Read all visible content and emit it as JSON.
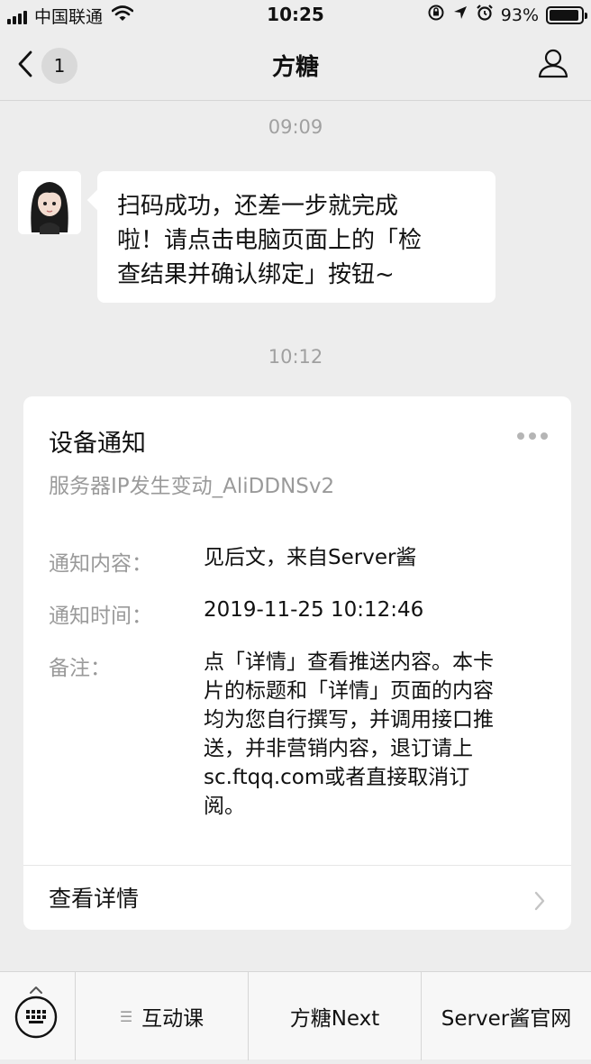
{
  "status_bar": {
    "carrier": "中国联通",
    "time": "10:25",
    "battery": "93%",
    "battery_level": 0.93
  },
  "nav": {
    "back_badge": "1",
    "title": "方糖"
  },
  "messages": {
    "time1": "09:09",
    "bubble_lines": [
      "扫码成功，还差一步就完成",
      "啦！请点击电脑页面上的「检",
      "查结果并确认绑定」按钮~"
    ],
    "time2": "10:12"
  },
  "card": {
    "title": "设备通知",
    "subtitle": "服务器IP发生变动_AliDDNSv2",
    "rows": [
      {
        "label": "通知内容：",
        "value": "见后文，来自Server酱"
      },
      {
        "label": "通知时间：",
        "value": "2019-11-25 10:12:46"
      },
      {
        "label": "备注：",
        "lines": [
          "点「详情」查看推送内容。本卡",
          "片的标题和「详情」页面的内容",
          "均为您自行撰写，并调用接口推",
          "送，并非营销内容，退订请上",
          "sc.ftqq.com或者直接取消订",
          "阅。"
        ]
      }
    ],
    "link": "查看详情"
  },
  "bottom": {
    "menus": [
      "互动课",
      "方糖Next",
      "Server酱官网"
    ]
  },
  "icons": [
    "back-chevron-icon",
    "profile-icon",
    "more-icon",
    "chevron-right-icon",
    "keyboard-icon",
    "menu-list-icon",
    "wifi-icon",
    "signal-icon",
    "battery-icon",
    "location-icon",
    "lock-rotation-icon",
    "alarm-icon"
  ]
}
